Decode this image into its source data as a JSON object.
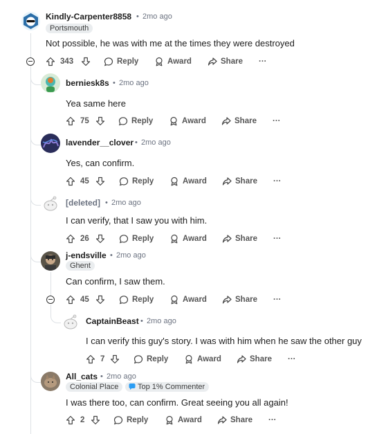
{
  "comments": [
    {
      "user": "Kindly-Carpenter8858",
      "time": "2mo ago",
      "flair": "Portsmouth",
      "text": "Not possible, he was with me at the times they were destroyed",
      "votes": "343"
    },
    {
      "user": "berniesk8s",
      "time": "2mo ago",
      "text": "Yea same here",
      "votes": "75"
    },
    {
      "user": "lavender__clover",
      "time": "2mo ago",
      "text": "Yes, can confirm.",
      "votes": "45"
    },
    {
      "user": "[deleted]",
      "time": "2mo ago",
      "text": "I can verify, that I saw you with him.",
      "votes": "26"
    },
    {
      "user": "j-endsville",
      "time": "2mo ago",
      "flair": "Ghent",
      "text": "Can confirm, I saw them.",
      "votes": "45"
    },
    {
      "user": "CaptainBeast",
      "time": "2mo ago",
      "text": "I can verify this guy's story. I was with him when he saw the other guy",
      "votes": "7"
    },
    {
      "user": "All_cats",
      "time": "2mo ago",
      "flair": "Colonial Place",
      "badge": "Top 1% Commenter",
      "text": "I was there too, can confirm. Great seeing you all again!",
      "votes": "2"
    }
  ],
  "actions": {
    "separator": "•",
    "reply": "Reply",
    "award": "Award",
    "share": "Share",
    "more": "···"
  },
  "colors": {
    "thread_line": "#dde1e5",
    "badge_icon": "#2a9df4"
  }
}
